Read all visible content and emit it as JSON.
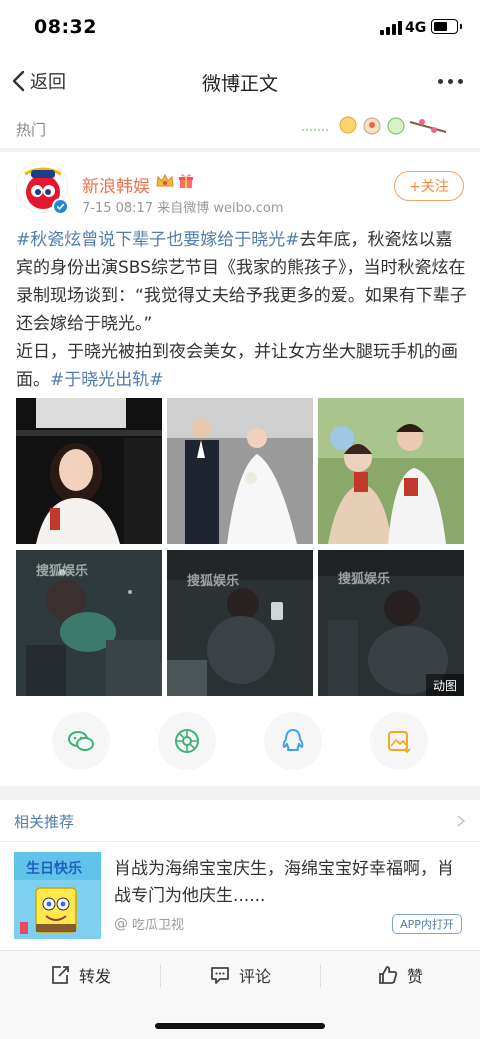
{
  "status_bar": {
    "time": "08:32",
    "network": "4G",
    "battery_level": 0.6
  },
  "nav": {
    "back_label": "返回",
    "title": "微博正文"
  },
  "hot_label": "热门",
  "post": {
    "author": "新浪韩娱",
    "meta": "7-15 08:17  来自微博 weibo.com",
    "follow_label": "+关注",
    "text_parts": {
      "tag1": "#秋瓷炫曾说下辈子也要嫁给于晓光#",
      "body1": "去年底，秋瓷炫以嘉宾的身份出演SBS综艺节目《我家的熊孩子》，当时秋瓷炫在录制现场谈到：“我觉得丈夫给予我更多的爱。如果有下辈子还会嫁给于晓光。”",
      "body2": "近日，于晓光被拍到夜会美女，并让女方坐大腿玩手机的画面。",
      "tag2": "#于晓光出轨#"
    },
    "photos": [
      {
        "name": "photo-woman-white-sweater"
      },
      {
        "name": "photo-wedding"
      },
      {
        "name": "photo-couple-selfie"
      },
      {
        "name": "photo-night-1",
        "watermark": "搜狐娱乐"
      },
      {
        "name": "photo-night-2",
        "watermark": "搜狐娱乐"
      },
      {
        "name": "photo-night-3",
        "watermark": "搜狐娱乐"
      }
    ],
    "gif_badge": "动图",
    "share_icons": [
      "wechat-icon",
      "moments-icon",
      "qq-icon",
      "save-image-icon"
    ]
  },
  "related": {
    "header": "相关推荐",
    "item": {
      "title": "肖战为海绵宝宝庆生，海绵宝宝好幸福啊，肖战专门为他庆生......",
      "source": "吃瓜卫视",
      "open_app": "APP内打开",
      "thumb_text": "生日快乐"
    }
  },
  "actions": {
    "repost": "转发",
    "comment": "评论",
    "like": "赞"
  },
  "colors": {
    "link": "#507daf",
    "author": "#eb7350",
    "follow": "#f28c3c"
  }
}
